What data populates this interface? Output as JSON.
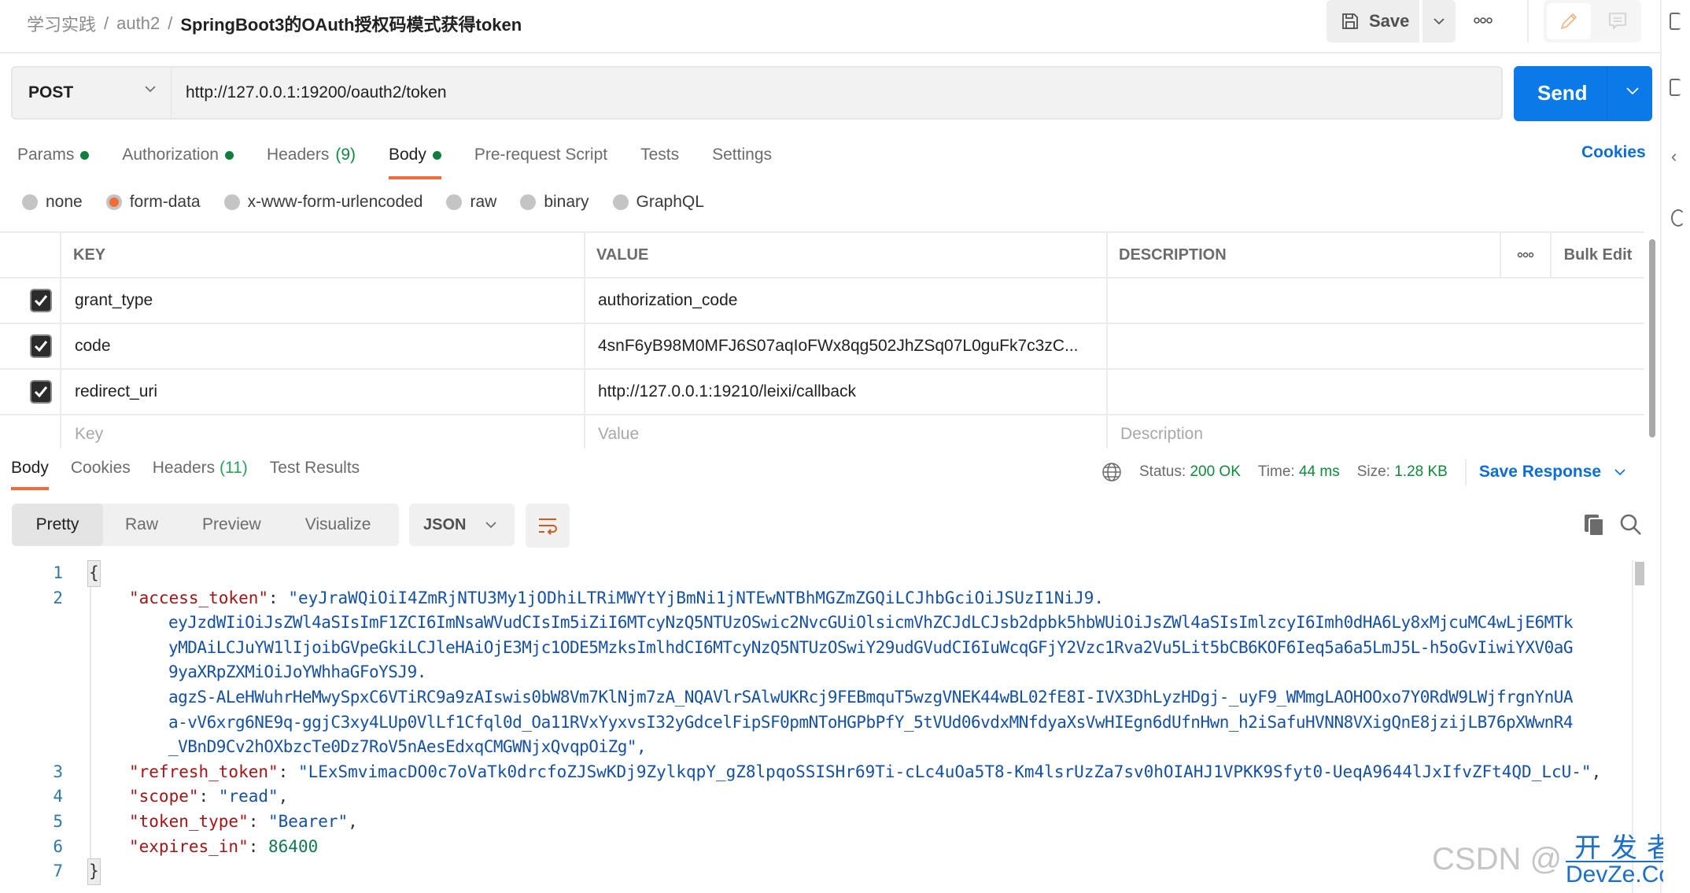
{
  "breadcrumb": {
    "items": [
      "学习实践",
      "auth2"
    ],
    "current": "SpringBoot3的OAuth授权码模式获得token",
    "separator": "/"
  },
  "header": {
    "save_label": "Save",
    "more_icon": "more-horizontal-icon",
    "edit_icon": "pencil-icon",
    "comment_icon": "comment-icon"
  },
  "request": {
    "method": "POST",
    "url": "http://127.0.0.1:19200/oauth2/token",
    "send_label": "Send",
    "cookies_label": "Cookies",
    "tabs": [
      {
        "label": "Params",
        "dot": true
      },
      {
        "label": "Authorization",
        "dot": true
      },
      {
        "label": "Headers",
        "count": "(9)"
      },
      {
        "label": "Body",
        "dot": true,
        "active": true
      },
      {
        "label": "Pre-request Script"
      },
      {
        "label": "Tests"
      },
      {
        "label": "Settings"
      }
    ],
    "body_types": [
      {
        "label": "none"
      },
      {
        "label": "form-data",
        "selected": true
      },
      {
        "label": "x-www-form-urlencoded"
      },
      {
        "label": "raw"
      },
      {
        "label": "binary"
      },
      {
        "label": "GraphQL"
      }
    ],
    "table": {
      "headers": {
        "key": "KEY",
        "value": "VALUE",
        "description": "DESCRIPTION",
        "bulk_edit": "Bulk Edit"
      },
      "rows": [
        {
          "checked": true,
          "key": "grant_type",
          "value": "authorization_code",
          "description": ""
        },
        {
          "checked": true,
          "key": "code",
          "value": "4snF6yB98M0MFJ6S07aqIoFWx8qg502JhZSq07L0guFk7c3zC...",
          "description": ""
        },
        {
          "checked": true,
          "key": "redirect_uri",
          "value": "http://127.0.0.1:19210/leixi/callback",
          "description": ""
        }
      ],
      "placeholders": {
        "key": "Key",
        "value": "Value",
        "description": "Description"
      }
    }
  },
  "response": {
    "tabs": [
      {
        "label": "Body",
        "active": true
      },
      {
        "label": "Cookies"
      },
      {
        "label": "Headers",
        "count": "(11)"
      },
      {
        "label": "Test Results"
      }
    ],
    "status_label": "Status:",
    "status": "200 OK",
    "time_label": "Time:",
    "time": "44 ms",
    "size_label": "Size:",
    "size": "1.28 KB",
    "save_response_label": "Save Response",
    "views": [
      "Pretty",
      "Raw",
      "Preview",
      "Visualize"
    ],
    "active_view": "Pretty",
    "format": "JSON",
    "line_numbers": [
      "1",
      "2",
      "",
      "",
      "",
      "",
      "",
      "",
      "3",
      "4",
      "5",
      "6",
      "7"
    ],
    "body": {
      "open_brace": "{",
      "close_brace": "}",
      "access_token_key": "\"access_token\"",
      "access_token_lines": [
        "\"eyJraWQiOiI4ZmRjNTU3My1jODhiLTRiMWYtYjBmNi1jNTEwNTBhMGZmZGQiLCJhbGciOiJSUzI1NiJ9.",
        "eyJzdWIiOiJsZWl4aSIsImF1ZCI6ImNsaWVudCIsIm5iZiI6MTcyNzQ5NTUzOSwic2NvcGUiOlsicmVhZCJdLCJsb2dpbk5hbWUiOiJsZWl4aSIsImlzcyI6Imh0dHA6Ly8xMjcuMC4wLjE6MTk",
        "yMDAiLCJuYW1lIjoibGVpeGkiLCJleHAiOjE3Mjc1ODE5MzksImlhdCI6MTcyNzQ5NTUzOSwiY29udGVudCI6IuWcqGFjY2Vzc1Rva2Vu5Lit5bCB6KOF6Ieq5a6a5LmJ5L-h5oGvIiwiYXV0aG",
        "9yaXRpZXMiOiJoYWhhaGFoYSJ9.",
        "agzS-ALeHWuhrHeMwySpxC6VTiRC9a9zAIswis0bW8Vm7KlNjm7zA_NQAVlrSAlwUKRcj9FEBmquT5wzgVNEK44wBL02fE8I-IVX3DhLyzHDgj-_uyF9_WMmgLAOHOOxo7Y0RdW9LWjfrgnYnUA",
        "a-vV6xrg6NE9q-ggjC3xy4LUp0VlLf1Cfql0d_Oa11RVxYyxvsI32yGdcelFipSF0pmNToHGPbPfY_5tVUd06vdxMNfdyaXsVwHIEgn6dUfnHwn_h2iSafuHVNN8VXigQnE8jzijLB76pXWwnR4",
        "_VBnD9Cv2hOXbzcTe0Dz7RoV5nAesEdxqCMGWNjxQvqpOiZg\","
      ],
      "refresh_token_key": "\"refresh_token\"",
      "refresh_token_value": "\"LExSmvimacDO0c7oVaTk0drcfoZJSwKDj9ZylkqpY_gZ8lpqoSSISHr69Ti-cLc4uOa5T8-Km4lsrUzZa7sv0hOIAHJ1VPKK9Sfyt0-UeqA9644lJxIfvZFt4QD_LcU-\"",
      "scope_key": "\"scope\"",
      "scope_value": "\"read\"",
      "token_type_key": "\"token_type\"",
      "token_type_value": "\"Bearer\"",
      "expires_in_key": "\"expires_in\"",
      "expires_in_value": "86400"
    }
  },
  "watermark": {
    "text": "CSDN @",
    "site_cn": "开发者",
    "site_en": "DevZe.CoM"
  },
  "colors": {
    "accent": "#f26b3a",
    "send": "#0b7ae8",
    "link": "#0b6ed8",
    "success": "#0e8a3c"
  }
}
